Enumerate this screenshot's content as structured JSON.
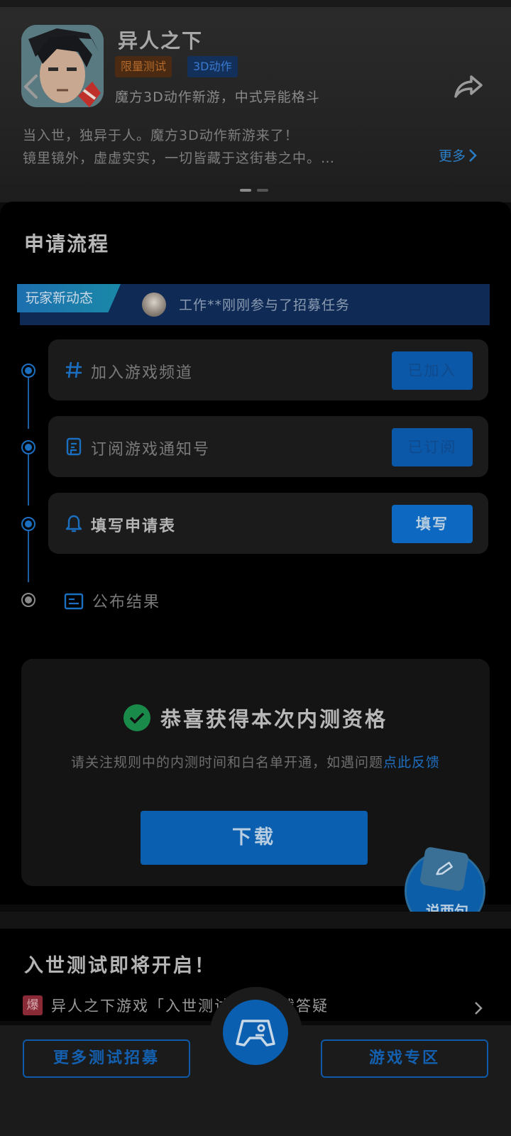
{
  "header": {
    "game_title": "异人之下",
    "tags": [
      "限量测试",
      "3D动作"
    ],
    "subtitle": "魔方3D动作新游，中式异能格斗",
    "description_line1": "当入世，独异于人。魔方3D动作新游来了！",
    "description_line2": "镜里镜外，虚虚实实，一切皆藏于这街巷之中。…",
    "more_label": "更多",
    "icons": {
      "back": "chevron-left-icon",
      "share": "share-icon"
    }
  },
  "process": {
    "title": "申请流程",
    "ticker": {
      "badge": "玩家新动态",
      "text": "工作**刚刚参与了招募任务"
    },
    "steps": [
      {
        "label": "加入游戏频道",
        "button": "已加入",
        "status": "done",
        "icon": "hash-icon"
      },
      {
        "label": "订阅游戏通知号",
        "button": "已订阅",
        "status": "done",
        "icon": "notice-icon"
      },
      {
        "label": "填写申请表",
        "button": "填写",
        "status": "active",
        "icon": "bell-icon"
      },
      {
        "label": "公布结果",
        "status": "pending",
        "icon": "result-icon"
      }
    ]
  },
  "success": {
    "title": "恭喜获得本次内测资格",
    "note_prefix": "请关注规则中的内测时间和白名单开通，如遇问题",
    "note_link": "点此反馈",
    "download_label": "下载"
  },
  "floating": {
    "talk_label": "说两句"
  },
  "section2": {
    "title": "入世测试即将开启！",
    "news_badge": "爆",
    "news_text": "异人之下游戏「入世测试」预下载答疑"
  },
  "bottom_bar": {
    "left_label": "更多测试招募",
    "right_label": "游戏专区"
  },
  "colors": {
    "accent": "#0b5fb0",
    "link": "#1f6fc0",
    "success": "#1a8a4a",
    "tag_limited": "#b46a2a",
    "tag_action": "#3a7ad0"
  }
}
